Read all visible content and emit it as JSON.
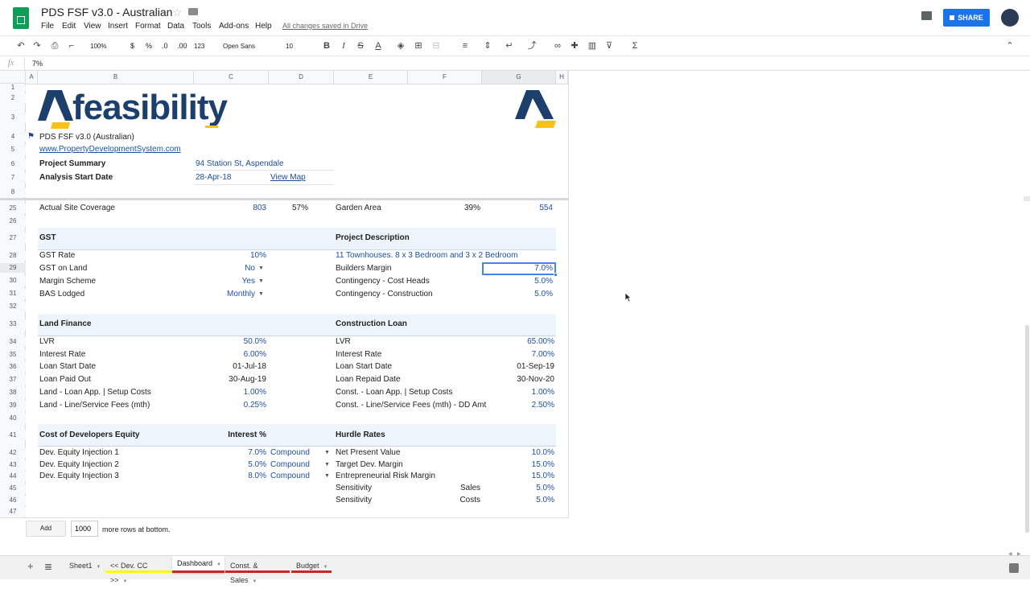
{
  "doc": {
    "title": "PDS FSF v3.0 - Australian",
    "menu": [
      "File",
      "Edit",
      "View",
      "Insert",
      "Format",
      "Data",
      "Tools",
      "Add-ons",
      "Help"
    ],
    "save_status": "All changes saved in Drive",
    "share_label": "SHARE"
  },
  "toolbar": {
    "zoom": "100%",
    "currency": "$",
    "percent": "%",
    "dec_less": ".0",
    "dec_more": ".00",
    "more_formats": "123",
    "font": "Open Sans",
    "font_size": "10"
  },
  "formula_bar": {
    "fx": "fx",
    "value": "7%"
  },
  "columns": [
    "A",
    "B",
    "C",
    "D",
    "E",
    "F",
    "G",
    "H"
  ],
  "rows": [
    "1",
    "2",
    "3",
    "4",
    "5",
    "6",
    "7",
    "8",
    "25",
    "26",
    "27",
    "28",
    "29",
    "30",
    "31",
    "32",
    "33",
    "34",
    "35",
    "36",
    "37",
    "38",
    "39",
    "40",
    "41",
    "42",
    "43",
    "44",
    "45",
    "46",
    "47"
  ],
  "logo": {
    "text": "feasibility"
  },
  "header": {
    "version": "PDS FSF v3.0 (Australian)",
    "website": "www.PropertyDevelopmentSystem.com",
    "project_summary_label": "Project Summary",
    "project_summary_value": "94 Station St, Aspendale",
    "start_label": "Analysis Start Date",
    "start_value": "28-Apr-18",
    "map_link": "View Map"
  },
  "row25": {
    "label": "Actual Site Coverage",
    "area": "803",
    "pct": "57%",
    "garden_label": "Garden Area",
    "garden_pct": "39%",
    "garden_area": "554"
  },
  "gst": {
    "title": "GST",
    "rows": [
      {
        "label": "GST Rate",
        "value": "10%"
      },
      {
        "label": "GST on Land",
        "value": "No"
      },
      {
        "label": "Margin Scheme",
        "value": "Yes"
      },
      {
        "label": "BAS Lodged",
        "value": "Monthly"
      }
    ]
  },
  "project": {
    "title": "Project Description",
    "description": "11 Townhouses. 8 x 3 Bedroom and 3 x 2 Bedroom",
    "rows": [
      {
        "label": "Builders Margin",
        "value": "7.0%"
      },
      {
        "label": "Contingency - Cost Heads",
        "value": "5.0%"
      },
      {
        "label": "Contingency - Construction",
        "value": "5.0%"
      }
    ]
  },
  "land_finance": {
    "title": "Land Finance",
    "rows": [
      {
        "label": "LVR",
        "value": "50.0%"
      },
      {
        "label": "Interest Rate",
        "value": "6.00%"
      },
      {
        "label": "Loan Start Date",
        "value": "01-Jul-18"
      },
      {
        "label": "Loan Paid Out",
        "value": "30-Aug-19"
      },
      {
        "label": "Land - Loan App. | Setup Costs",
        "value": "1.00%"
      },
      {
        "label": "Land - Line/Service Fees  (mth)",
        "value": "0.25%"
      }
    ]
  },
  "construction_loan": {
    "title": "Construction Loan",
    "rows": [
      {
        "label": "LVR",
        "value": "65.00%"
      },
      {
        "label": "Interest Rate",
        "value": "7.00%"
      },
      {
        "label": "Loan Start Date",
        "value": "01-Sep-19"
      },
      {
        "label": "Loan Repaid Date",
        "value": "30-Nov-20"
      },
      {
        "label": "Const. - Loan App. | Setup Costs",
        "value": "1.00%"
      },
      {
        "label": "Const. - Line/Service Fees (mth) - DD Amt",
        "value": "2.50%"
      }
    ]
  },
  "equity": {
    "title": "Cost of Developers Equity",
    "interest_header": "Interest %",
    "rows": [
      {
        "label": "Dev. Equity Injection 1",
        "rate": "7.0%",
        "type": "Compound"
      },
      {
        "label": "Dev. Equity Injection 2",
        "rate": "5.0%",
        "type": "Compound"
      },
      {
        "label": "Dev. Equity Injection 3",
        "rate": "8.0%",
        "type": "Compound"
      }
    ]
  },
  "hurdle": {
    "title": "Hurdle Rates",
    "rows": [
      {
        "label": "Net Present Value",
        "sub": "",
        "value": "10.0%"
      },
      {
        "label": "Target Dev. Margin",
        "sub": "",
        "value": "15.0%"
      },
      {
        "label": "Entrepreneurial Risk Margin",
        "sub": "",
        "value": "15.0%"
      },
      {
        "label": "Sensitivity",
        "sub": "Sales",
        "value": "5.0%"
      },
      {
        "label": "Sensitivity",
        "sub": "Costs",
        "value": "5.0%"
      }
    ]
  },
  "add_rows": {
    "button": "Add",
    "count": "1000",
    "suffix": "more rows at bottom."
  },
  "sheets": [
    {
      "name": "Sheet1",
      "color": ""
    },
    {
      "name": "<< Dev. CC >>",
      "color": "#ffff00"
    },
    {
      "name": "Dashboard",
      "color": "#c62828"
    },
    {
      "name": "Const. & Sales",
      "color": "#c62828"
    },
    {
      "name": "Budget",
      "color": "#c62828"
    }
  ]
}
